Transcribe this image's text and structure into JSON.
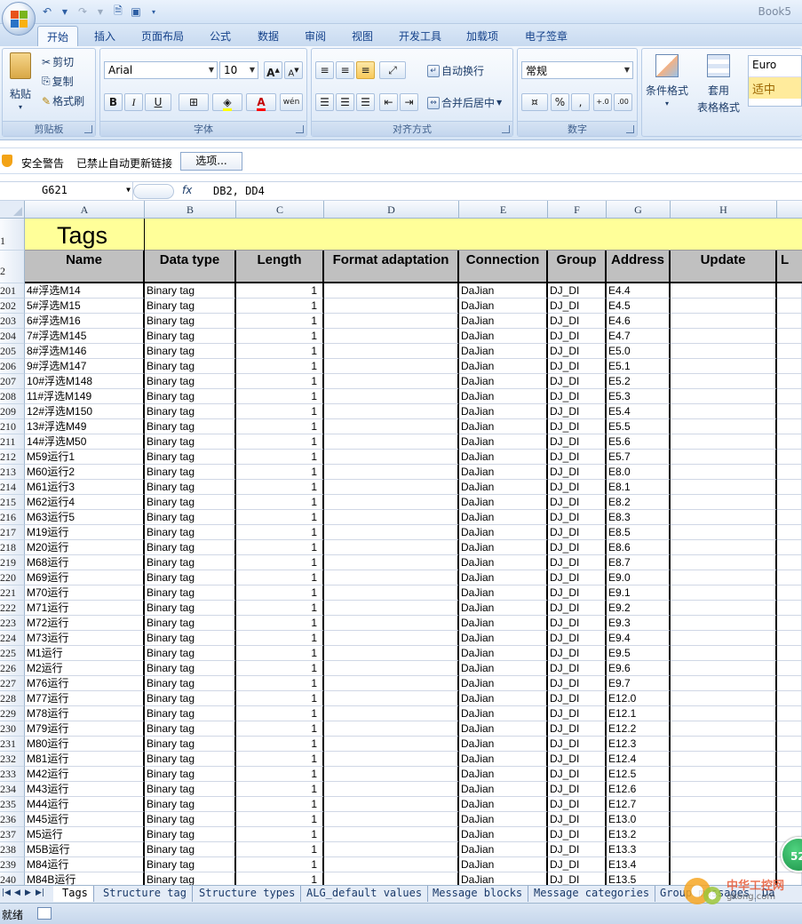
{
  "app": {
    "title": "Book5",
    "quick_access": [
      "undo",
      "redo",
      "print-preview",
      "save"
    ]
  },
  "ribbon_tabs": [
    "开始",
    "插入",
    "页面布局",
    "公式",
    "数据",
    "审阅",
    "视图",
    "开发工具",
    "加载项",
    "电子签章"
  ],
  "clipboard": {
    "paste": "粘贴",
    "cut": "剪切",
    "copy": "复制",
    "format_painter": "格式刷",
    "label": "剪贴板"
  },
  "font": {
    "name": "Arial",
    "size": "10",
    "bold": "B",
    "italic": "I",
    "underline": "U",
    "grow": "A",
    "shrink": "A",
    "label": "字体",
    "pinyin": "wén"
  },
  "alignment": {
    "wrap": "自动换行",
    "merge": "合并后居中",
    "label": "对齐方式"
  },
  "number": {
    "format": "常规",
    "percent": "%",
    "comma": ",",
    "inc_decimal": "+.0",
    "dec_decimal": ".00",
    "label": "数字"
  },
  "styles": {
    "conditional": "条件格式",
    "table_format_1": "套用",
    "table_format_2": "表格格式",
    "style1": "Euro",
    "style2": "适中"
  },
  "security_bar": {
    "title": "安全警告",
    "message": "已禁止自动更新链接",
    "options_button": "选项..."
  },
  "formula_bar": {
    "name_box": "G621",
    "fx": "fx",
    "formula": "DB2, DD4"
  },
  "columns": [
    "A",
    "B",
    "C",
    "D",
    "E",
    "F",
    "G",
    "H",
    ""
  ],
  "header_rows": [
    "1",
    "2"
  ],
  "sheet_title": "Tags",
  "table_headers": [
    "Name",
    "Data type",
    "Length",
    "Format adaptation",
    "Connection",
    "Group",
    "Address",
    "Update",
    "L"
  ],
  "rows": [
    {
      "row": "201",
      "name": "4#浮选M14",
      "type": "Binary tag",
      "length": "1",
      "conn": "DaJian",
      "group": "DJ_DI",
      "addr": "E4.4"
    },
    {
      "row": "202",
      "name": "5#浮选M15",
      "type": "Binary tag",
      "length": "1",
      "conn": "DaJian",
      "group": "DJ_DI",
      "addr": "E4.5"
    },
    {
      "row": "203",
      "name": "6#浮选M16",
      "type": "Binary tag",
      "length": "1",
      "conn": "DaJian",
      "group": "DJ_DI",
      "addr": "E4.6"
    },
    {
      "row": "204",
      "name": "7#浮选M145",
      "type": "Binary tag",
      "length": "1",
      "conn": "DaJian",
      "group": "DJ_DI",
      "addr": "E4.7"
    },
    {
      "row": "205",
      "name": "8#浮选M146",
      "type": "Binary tag",
      "length": "1",
      "conn": "DaJian",
      "group": "DJ_DI",
      "addr": "E5.0"
    },
    {
      "row": "206",
      "name": "9#浮选M147",
      "type": "Binary tag",
      "length": "1",
      "conn": "DaJian",
      "group": "DJ_DI",
      "addr": "E5.1"
    },
    {
      "row": "207",
      "name": "10#浮选M148",
      "type": "Binary tag",
      "length": "1",
      "conn": "DaJian",
      "group": "DJ_DI",
      "addr": "E5.2"
    },
    {
      "row": "208",
      "name": "11#浮选M149",
      "type": "Binary tag",
      "length": "1",
      "conn": "DaJian",
      "group": "DJ_DI",
      "addr": "E5.3"
    },
    {
      "row": "209",
      "name": "12#浮选M150",
      "type": "Binary tag",
      "length": "1",
      "conn": "DaJian",
      "group": "DJ_DI",
      "addr": "E5.4"
    },
    {
      "row": "210",
      "name": "13#浮选M49",
      "type": "Binary tag",
      "length": "1",
      "conn": "DaJian",
      "group": "DJ_DI",
      "addr": "E5.5"
    },
    {
      "row": "211",
      "name": "14#浮选M50",
      "type": "Binary tag",
      "length": "1",
      "conn": "DaJian",
      "group": "DJ_DI",
      "addr": "E5.6"
    },
    {
      "row": "212",
      "name": "M59运行1",
      "type": "Binary tag",
      "length": "1",
      "conn": "DaJian",
      "group": "DJ_DI",
      "addr": "E5.7"
    },
    {
      "row": "213",
      "name": "M60运行2",
      "type": "Binary tag",
      "length": "1",
      "conn": "DaJian",
      "group": "DJ_DI",
      "addr": "E8.0"
    },
    {
      "row": "214",
      "name": "M61运行3",
      "type": "Binary tag",
      "length": "1",
      "conn": "DaJian",
      "group": "DJ_DI",
      "addr": "E8.1"
    },
    {
      "row": "215",
      "name": "M62运行4",
      "type": "Binary tag",
      "length": "1",
      "conn": "DaJian",
      "group": "DJ_DI",
      "addr": "E8.2"
    },
    {
      "row": "216",
      "name": "M63运行5",
      "type": "Binary tag",
      "length": "1",
      "conn": "DaJian",
      "group": "DJ_DI",
      "addr": "E8.3"
    },
    {
      "row": "217",
      "name": "M19运行",
      "type": "Binary tag",
      "length": "1",
      "conn": "DaJian",
      "group": "DJ_DI",
      "addr": "E8.5"
    },
    {
      "row": "218",
      "name": "M20运行",
      "type": "Binary tag",
      "length": "1",
      "conn": "DaJian",
      "group": "DJ_DI",
      "addr": "E8.6"
    },
    {
      "row": "219",
      "name": "M68运行",
      "type": "Binary tag",
      "length": "1",
      "conn": "DaJian",
      "group": "DJ_DI",
      "addr": "E8.7"
    },
    {
      "row": "220",
      "name": "M69运行",
      "type": "Binary tag",
      "length": "1",
      "conn": "DaJian",
      "group": "DJ_DI",
      "addr": "E9.0"
    },
    {
      "row": "221",
      "name": "M70运行",
      "type": "Binary tag",
      "length": "1",
      "conn": "DaJian",
      "group": "DJ_DI",
      "addr": "E9.1"
    },
    {
      "row": "222",
      "name": "M71运行",
      "type": "Binary tag",
      "length": "1",
      "conn": "DaJian",
      "group": "DJ_DI",
      "addr": "E9.2"
    },
    {
      "row": "223",
      "name": "M72运行",
      "type": "Binary tag",
      "length": "1",
      "conn": "DaJian",
      "group": "DJ_DI",
      "addr": "E9.3"
    },
    {
      "row": "224",
      "name": "M73运行",
      "type": "Binary tag",
      "length": "1",
      "conn": "DaJian",
      "group": "DJ_DI",
      "addr": "E9.4"
    },
    {
      "row": "225",
      "name": "M1运行",
      "type": "Binary tag",
      "length": "1",
      "conn": "DaJian",
      "group": "DJ_DI",
      "addr": "E9.5"
    },
    {
      "row": "226",
      "name": "M2运行",
      "type": "Binary tag",
      "length": "1",
      "conn": "DaJian",
      "group": "DJ_DI",
      "addr": "E9.6"
    },
    {
      "row": "227",
      "name": "M76运行",
      "type": "Binary tag",
      "length": "1",
      "conn": "DaJian",
      "group": "DJ_DI",
      "addr": "E9.7"
    },
    {
      "row": "228",
      "name": "M77运行",
      "type": "Binary tag",
      "length": "1",
      "conn": "DaJian",
      "group": "DJ_DI",
      "addr": "E12.0"
    },
    {
      "row": "229",
      "name": "M78运行",
      "type": "Binary tag",
      "length": "1",
      "conn": "DaJian",
      "group": "DJ_DI",
      "addr": "E12.1"
    },
    {
      "row": "230",
      "name": "M79运行",
      "type": "Binary tag",
      "length": "1",
      "conn": "DaJian",
      "group": "DJ_DI",
      "addr": "E12.2"
    },
    {
      "row": "231",
      "name": "M80运行",
      "type": "Binary tag",
      "length": "1",
      "conn": "DaJian",
      "group": "DJ_DI",
      "addr": "E12.3"
    },
    {
      "row": "232",
      "name": "M81运行",
      "type": "Binary tag",
      "length": "1",
      "conn": "DaJian",
      "group": "DJ_DI",
      "addr": "E12.4"
    },
    {
      "row": "233",
      "name": "M42运行",
      "type": "Binary tag",
      "length": "1",
      "conn": "DaJian",
      "group": "DJ_DI",
      "addr": "E12.5"
    },
    {
      "row": "234",
      "name": "M43运行",
      "type": "Binary tag",
      "length": "1",
      "conn": "DaJian",
      "group": "DJ_DI",
      "addr": "E12.6"
    },
    {
      "row": "235",
      "name": "M44运行",
      "type": "Binary tag",
      "length": "1",
      "conn": "DaJian",
      "group": "DJ_DI",
      "addr": "E12.7"
    },
    {
      "row": "236",
      "name": "M45运行",
      "type": "Binary tag",
      "length": "1",
      "conn": "DaJian",
      "group": "DJ_DI",
      "addr": "E13.0"
    },
    {
      "row": "237",
      "name": "M5运行",
      "type": "Binary tag",
      "length": "1",
      "conn": "DaJian",
      "group": "DJ_DI",
      "addr": "E13.2"
    },
    {
      "row": "238",
      "name": "M5B运行",
      "type": "Binary tag",
      "length": "1",
      "conn": "DaJian",
      "group": "DJ_DI",
      "addr": "E13.3"
    },
    {
      "row": "239",
      "name": "M84运行",
      "type": "Binary tag",
      "length": "1",
      "conn": "DaJian",
      "group": "DJ_DI",
      "addr": "E13.4"
    },
    {
      "row": "240",
      "name": "M84B运行",
      "type": "Binary tag",
      "length": "1",
      "conn": "DaJian",
      "group": "DJ_DI",
      "addr": "E13.5"
    }
  ],
  "sheet_tabs": [
    "Tags",
    "Structure tag",
    "Structure types",
    "ALG_default values",
    "Message blocks",
    "Message categories",
    "Group messages",
    "Da"
  ],
  "status": {
    "ready": "就绪"
  },
  "badge": "52",
  "watermark": {
    "brand": "中华工控网",
    "url": "gkong.com"
  },
  "colors": {
    "title_row": "#ffff99",
    "header_row": "#c0c0c0",
    "ribbon": "#dbe8f7",
    "accent": "#15428b"
  }
}
